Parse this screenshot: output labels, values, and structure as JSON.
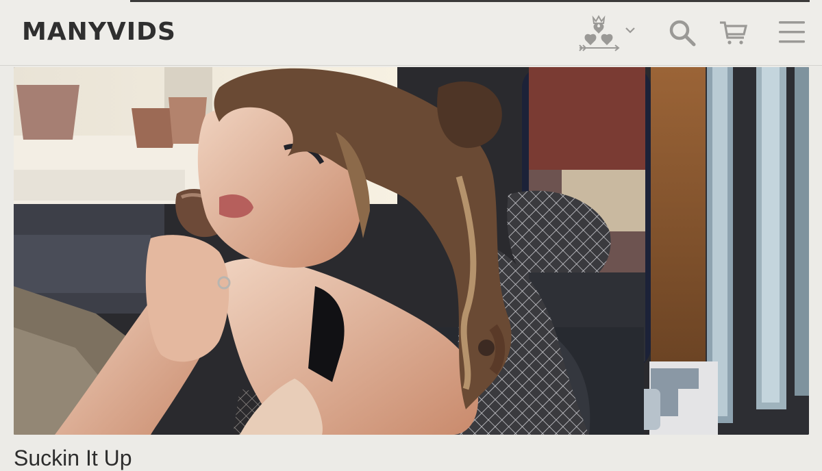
{
  "header": {
    "logo_text": "MANYVIDS",
    "icons": [
      "account-crest-icon",
      "chevron-down-icon",
      "search-icon",
      "cart-icon",
      "menu-icon"
    ]
  },
  "video": {
    "title": "Suckin It Up"
  },
  "colors": {
    "header_bg": "#eeede9",
    "page_bg": "#ecebe7",
    "logo": "#2f2f2f",
    "icon_gray": "#9a9996"
  }
}
